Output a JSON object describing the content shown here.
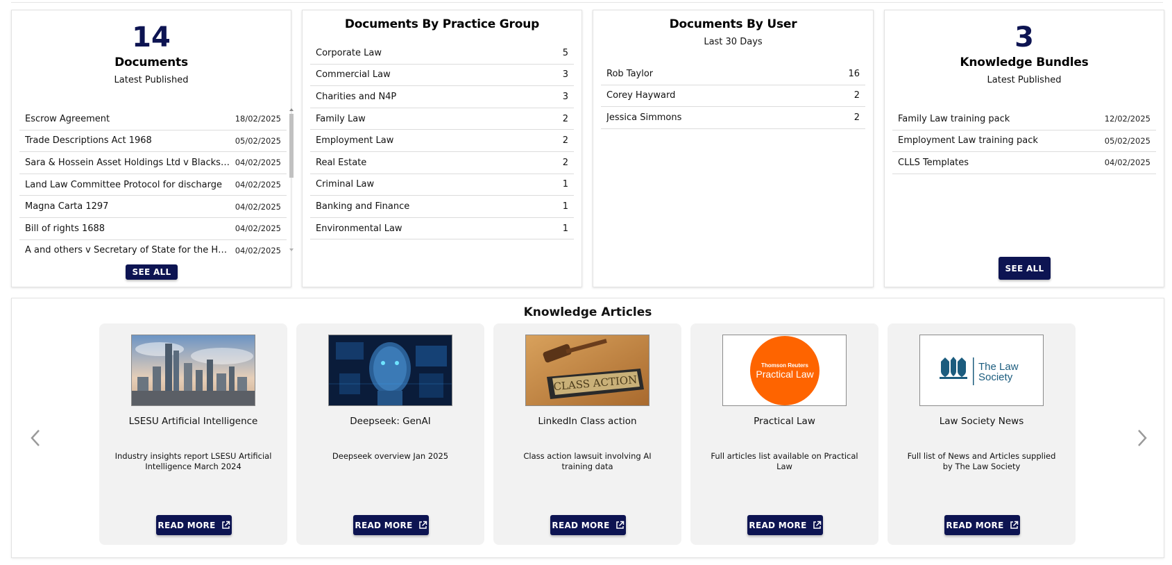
{
  "documents_card": {
    "count": "14",
    "title": "Documents",
    "subtitle": "Latest Published",
    "items": [
      {
        "name": "Escrow Agreement",
        "date": "18/02/2025"
      },
      {
        "name": "Trade Descriptions Act 1968",
        "date": "05/02/2025"
      },
      {
        "name": "Sara & Hossein Asset Holdings Ltd v Blackstone",
        "date": "04/02/2025"
      },
      {
        "name": "Land Law Committee Protocol for discharge",
        "date": "04/02/2025"
      },
      {
        "name": "Magna Carta 1297",
        "date": "04/02/2025"
      },
      {
        "name": "Bill of rights 1688",
        "date": "04/02/2025"
      },
      {
        "name": "A and others v Secretary of State for the Home Department",
        "date": "04/02/2025"
      }
    ],
    "see_all_label": "SEE ALL"
  },
  "practice_group_card": {
    "title": "Documents By Practice Group",
    "items": [
      {
        "name": "Corporate Law",
        "count": "5"
      },
      {
        "name": "Commercial Law",
        "count": "3"
      },
      {
        "name": "Charities and N4P",
        "count": "3"
      },
      {
        "name": "Family Law",
        "count": "2"
      },
      {
        "name": "Employment Law",
        "count": "2"
      },
      {
        "name": "Real Estate",
        "count": "2"
      },
      {
        "name": "Criminal Law",
        "count": "1"
      },
      {
        "name": "Banking and Finance",
        "count": "1"
      },
      {
        "name": "Environmental Law",
        "count": "1"
      }
    ]
  },
  "user_card": {
    "title": "Documents By User",
    "subtitle": "Last 30 Days",
    "items": [
      {
        "name": "Rob Taylor",
        "count": "16"
      },
      {
        "name": "Corey Hayward",
        "count": "2"
      },
      {
        "name": "Jessica Simmons",
        "count": "2"
      }
    ]
  },
  "bundles_card": {
    "count": "3",
    "title": "Knowledge Bundles",
    "subtitle": "Latest Published",
    "items": [
      {
        "name": "Family Law training pack",
        "date": "12/02/2025"
      },
      {
        "name": "Employment Law training pack",
        "date": "05/02/2025"
      },
      {
        "name": "CLLS Templates",
        "date": "04/02/2025"
      }
    ],
    "see_all_label": "SEE ALL"
  },
  "articles": {
    "title": "Knowledge Articles",
    "read_more_label": "READ MORE",
    "items": [
      {
        "title": "LSESU Artificial Intelligence",
        "description": "Industry insights report LSESU Artificial Intelligence March 2024",
        "image": "city-skyline"
      },
      {
        "title": "Deepseek: GenAI",
        "description": "Deepseek overview Jan 2025",
        "image": "ai-face"
      },
      {
        "title": "LinkedIn Class action",
        "description": "Class action lawsuit involving AI training data",
        "image": "gavel-class-action",
        "image_text": "CLASS ACTION"
      },
      {
        "title": "Practical Law",
        "description": "Full articles list available on Practical Law",
        "image": "practical-law-logo",
        "logo_top": "Thomson Reuters",
        "logo_main": "Practical Law"
      },
      {
        "title": "Law Society News",
        "description": "Full list of News and Articles supplied by The Law Society",
        "image": "law-society-logo",
        "logo_line1": "The Law",
        "logo_line2": "Society"
      }
    ]
  },
  "colors": {
    "brand_navy": "#0d1452",
    "practical_law_orange": "#fe6400",
    "law_society_teal": "#1b5c7e"
  }
}
